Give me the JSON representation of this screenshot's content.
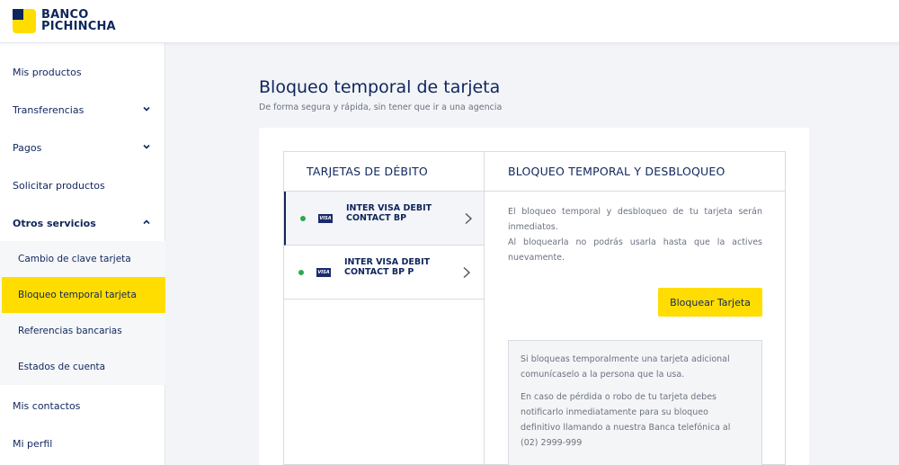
{
  "brand": {
    "line1": "BANCO",
    "line2": "PICHINCHA"
  },
  "sidebar": {
    "items": [
      {
        "label": "Mis productos"
      },
      {
        "label": "Transferencias"
      },
      {
        "label": "Pagos"
      },
      {
        "label": "Solicitar productos"
      },
      {
        "label": "Otros servicios"
      }
    ],
    "subitems": [
      {
        "label": "Cambio de clave tarjeta"
      },
      {
        "label": "Bloqueo temporal tarjeta"
      },
      {
        "label": "Referencias bancarias"
      },
      {
        "label": "Estados de cuenta"
      }
    ],
    "bottom_items": [
      {
        "label": "Mis contactos"
      },
      {
        "label": "Mi perfil"
      }
    ]
  },
  "main": {
    "title": "Bloqueo temporal de tarjeta",
    "subtitle": "De forma segura y rápida, sin tener que ir a una agencia",
    "left_panel": {
      "header": "TARJETAS DE DÉBITO",
      "cards": [
        {
          "brand": "VISA",
          "name": "INTER VISA DEBIT CONTACT BP"
        },
        {
          "brand": "VISA",
          "name": "INTER VISA DEBIT CONTACT BP P"
        }
      ]
    },
    "right_panel": {
      "header": "BLOQUEO TEMPORAL Y DESBLOQUEO",
      "info": "El bloqueo temporal y desbloqueo de tu tarjeta serán inmediatos.",
      "info2": "Al bloquearla no podrás usarla hasta que la actives nuevamente.",
      "button_label": "Bloquear Tarjeta",
      "notice1": "Si bloqueas temporalmente una tarjeta adicional comunícaselo a la persona que la usa.",
      "notice2": "En caso de pérdida o robo de tu tarjeta debes notificarlo inmediatamente para su bloqueo definitivo llamando a nuestra Banca telefónica al (02) 2999-999"
    }
  },
  "colors": {
    "brand_yellow": "#ffdd00",
    "brand_navy": "#0f265c",
    "status_green": "#2fa84f"
  }
}
